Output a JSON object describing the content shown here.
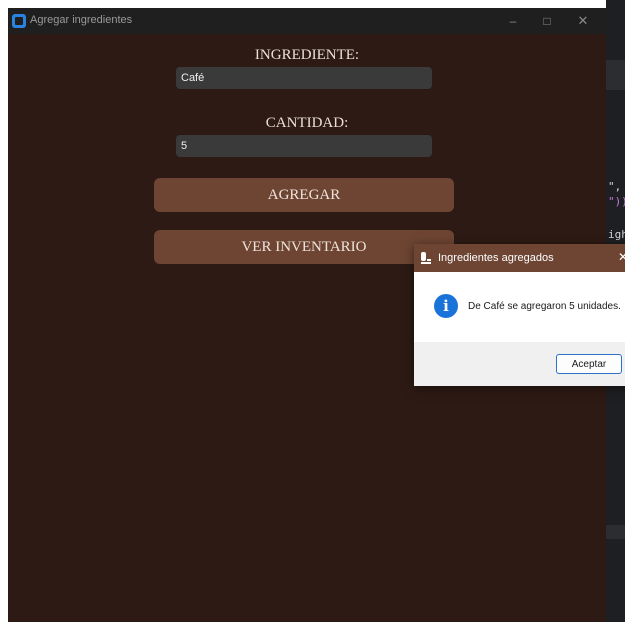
{
  "window": {
    "title": "Agregar ingredientes",
    "min_glyph": "–",
    "max_glyph": "□",
    "close_glyph": "✕"
  },
  "form": {
    "ingredient_label": "INGREDIENTE:",
    "ingredient_value": "Café",
    "quantity_label": "CANTIDAD:",
    "quantity_value": "5",
    "add_button": "AGREGAR",
    "inventory_button": "VER INVENTARIO"
  },
  "dialog": {
    "title": "Ingredientes agregados",
    "close_glyph": "✕",
    "message": "De Café se agregaron 5 unidades.",
    "info_glyph": "i",
    "ok_button": "Aceptar"
  },
  "editor": {
    "line1": "\",",
    "line2": "\"))",
    "line3": "igh"
  },
  "colors": {
    "window_bg": "#2e1a14",
    "button_bg": "#6e4533",
    "info_blue": "#1a73d9"
  }
}
